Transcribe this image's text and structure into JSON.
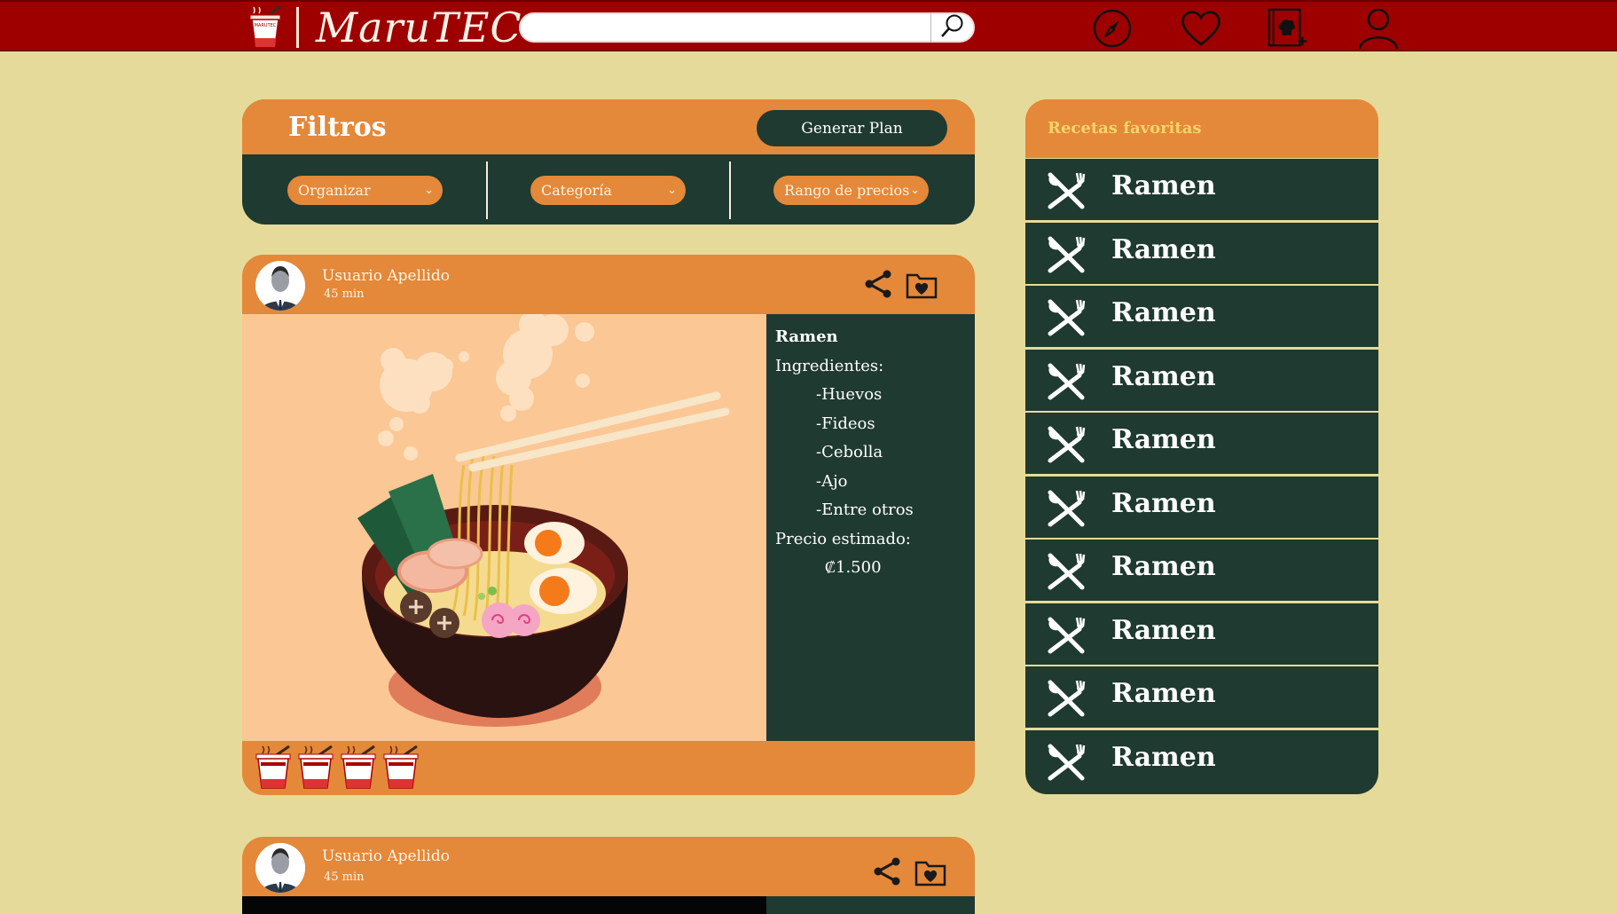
{
  "app": {
    "brand": "MaruTEC",
    "logo_text": "MARUTEC"
  },
  "search": {
    "value": "",
    "placeholder": ""
  },
  "nav": {
    "icons": [
      "compass-icon",
      "heart-icon",
      "recipe-book-add-icon",
      "user-icon"
    ]
  },
  "filters": {
    "title": "Filtros",
    "plan_button": "Generar Plan",
    "selects": [
      "Organizar",
      "Categoría",
      "Rango de precios"
    ]
  },
  "post": {
    "user": "Usuario Apellido",
    "time": "45 min",
    "recipe": {
      "title": "Ramen",
      "ingredients_label": "Ingredientes:",
      "ingredients": [
        "-Huevos",
        "-Fideos",
        "-Cebolla",
        "-Ajo",
        "-Entre otros"
      ],
      "price_label": "Precio estimado:",
      "price": "₡1.500"
    },
    "rating": 4
  },
  "post2": {
    "user": "Usuario Apellido",
    "time": "45 min"
  },
  "favorites": {
    "title": "Recetas favoritas",
    "items": [
      "Ramen",
      "Ramen",
      "Ramen",
      "Ramen",
      "Ramen",
      "Ramen",
      "Ramen",
      "Ramen",
      "Ramen",
      "Ramen"
    ]
  },
  "colors": {
    "topbar": "#9e0000",
    "background": "#e6da9a",
    "accent_orange": "#e4883a",
    "dark_green": "#1f3a30",
    "fav_title": "#f8d46a"
  }
}
